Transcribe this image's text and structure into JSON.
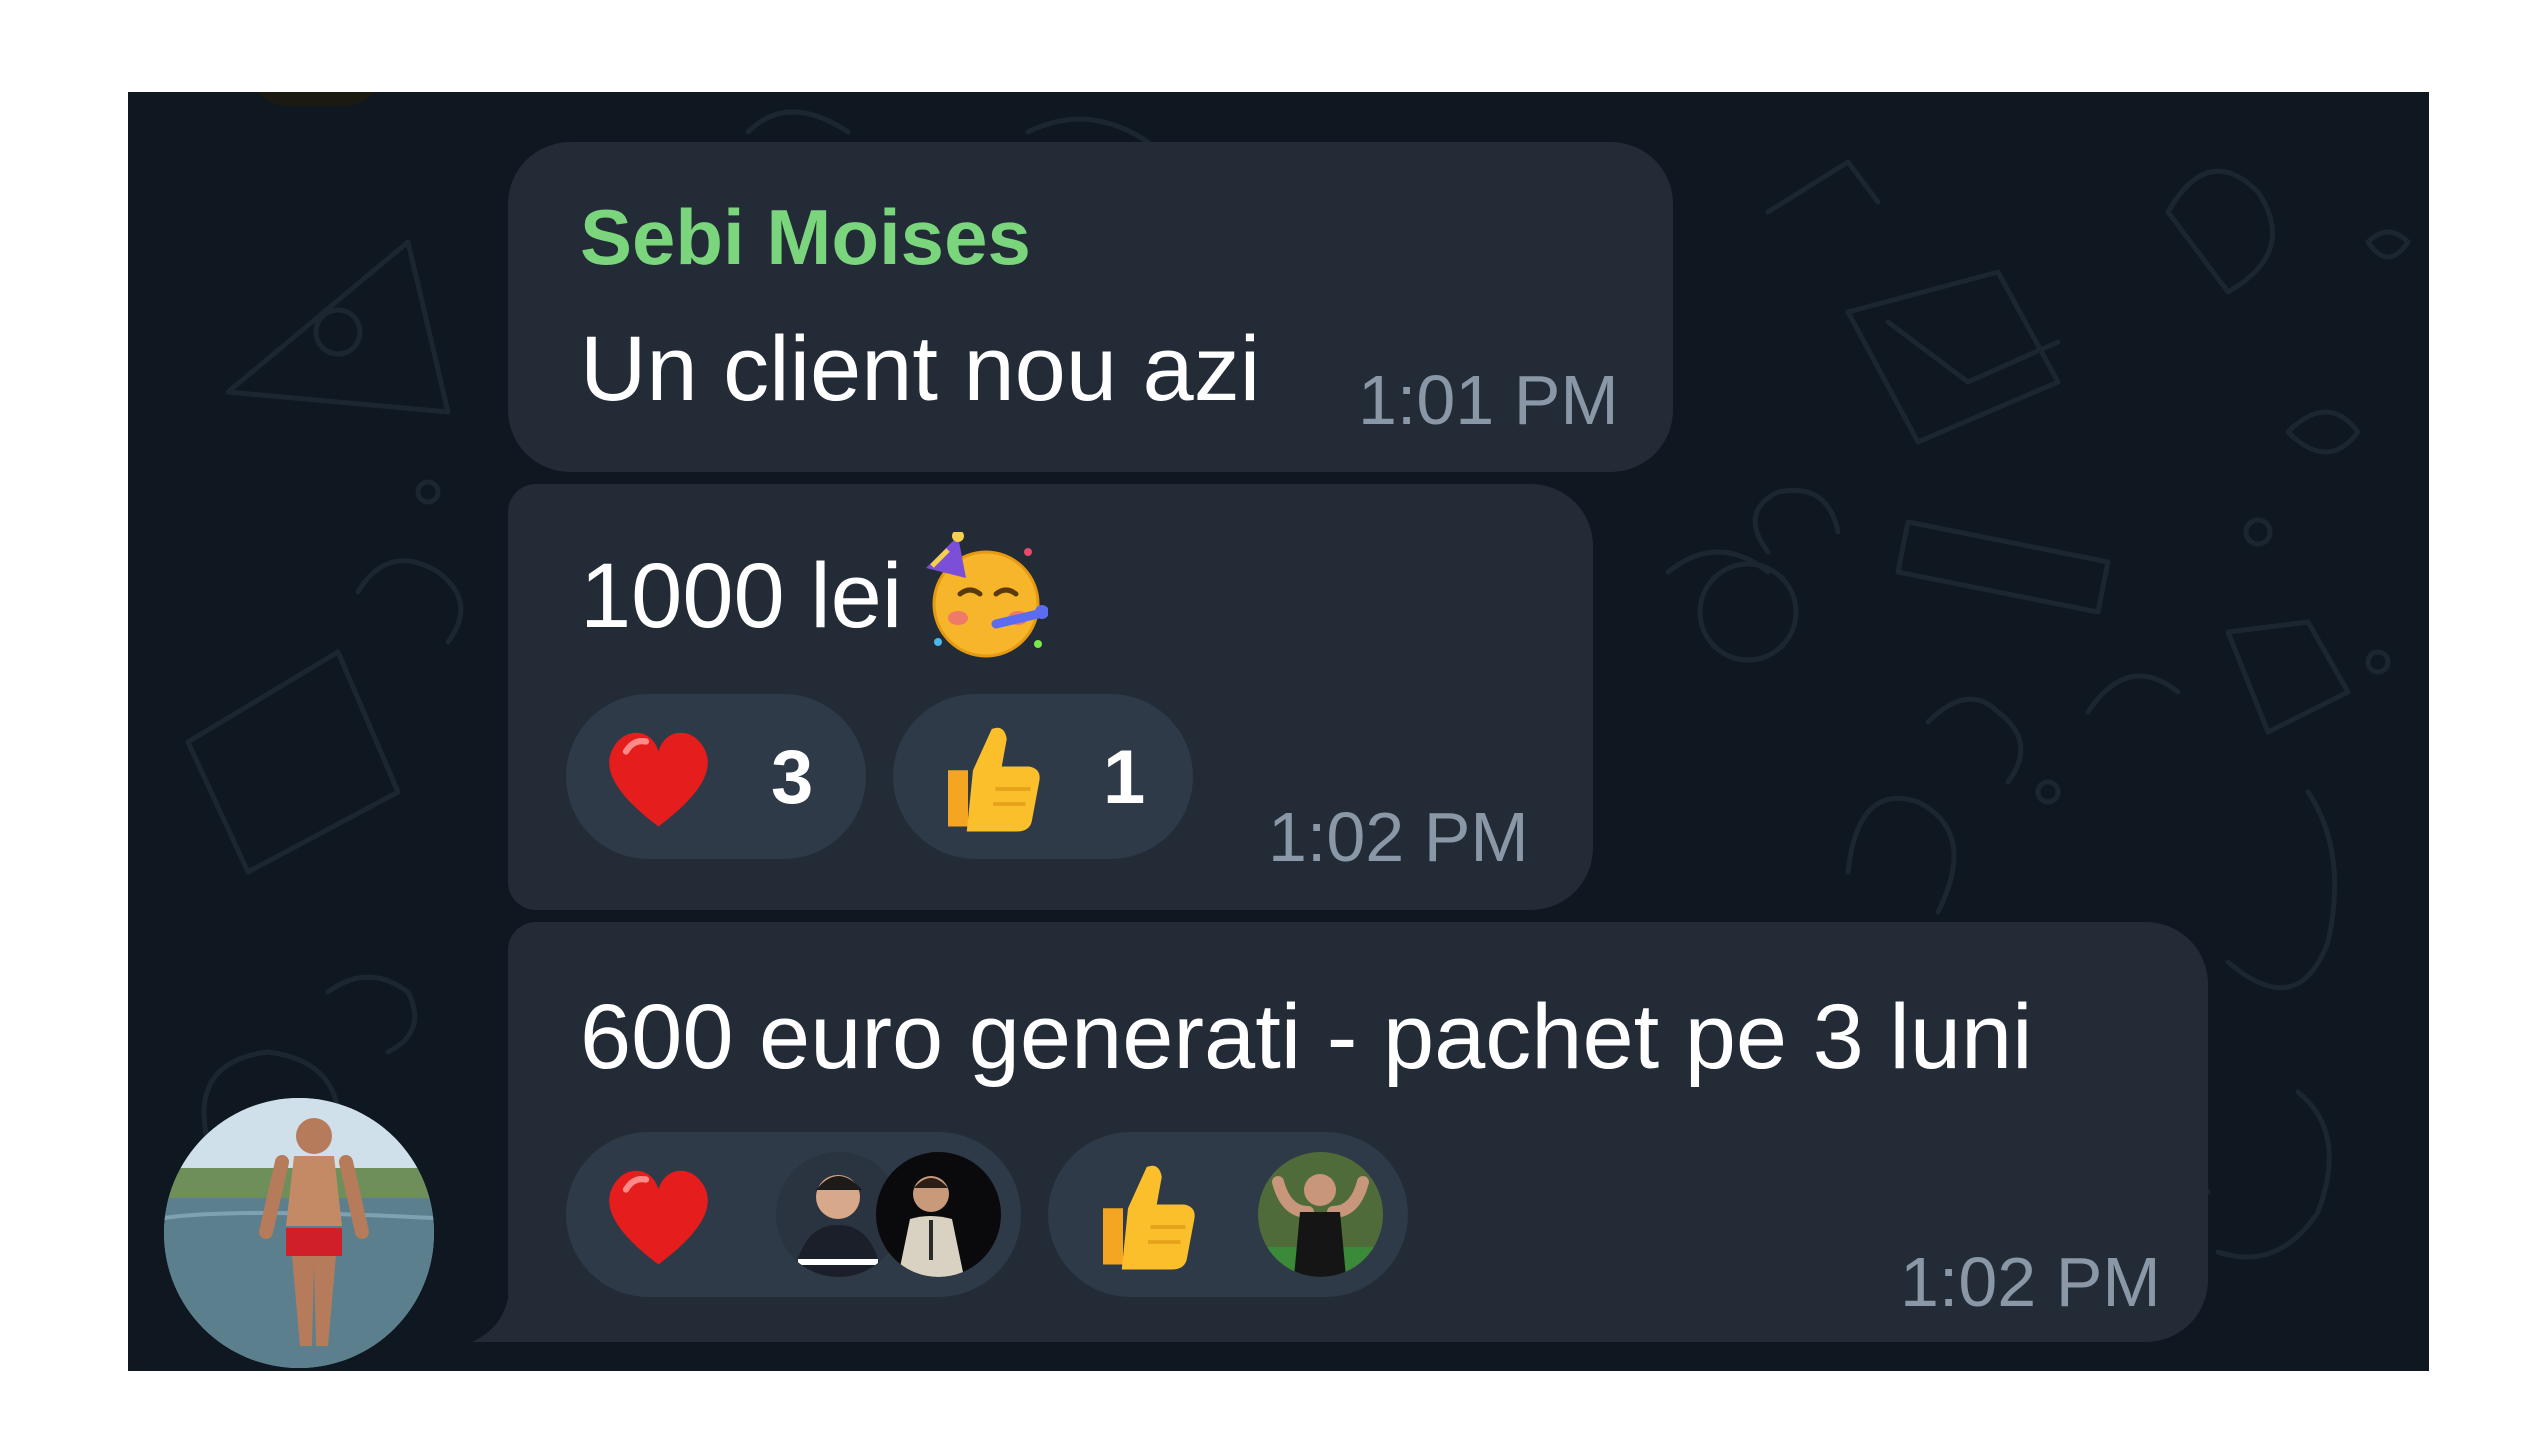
{
  "messages": [
    {
      "sender": "Sebi Moises",
      "text": "Un client nou azi",
      "time": "1:01 PM"
    },
    {
      "text": "1000 lei",
      "emoji": "partying-face-icon",
      "time": "1:02 PM",
      "reactions": [
        {
          "emoji": "heart-icon",
          "count": "3"
        },
        {
          "emoji": "thumbs-up-icon",
          "count": "1"
        }
      ]
    },
    {
      "text": "600 euro generati - pachet pe 3 luni",
      "time": "1:02 PM",
      "reactions": [
        {
          "emoji": "heart-icon",
          "users": [
            "reactor-avatar-1",
            "reactor-avatar-2"
          ]
        },
        {
          "emoji": "thumbs-up-icon",
          "users": [
            "reactor-avatar-3"
          ]
        }
      ]
    }
  ],
  "colors": {
    "background": "#0f1720",
    "bubble": "#222b36",
    "reaction": "#2e3a48",
    "sender_name": "#7ad57c",
    "time": "#8a97a6",
    "text": "#ffffff"
  }
}
